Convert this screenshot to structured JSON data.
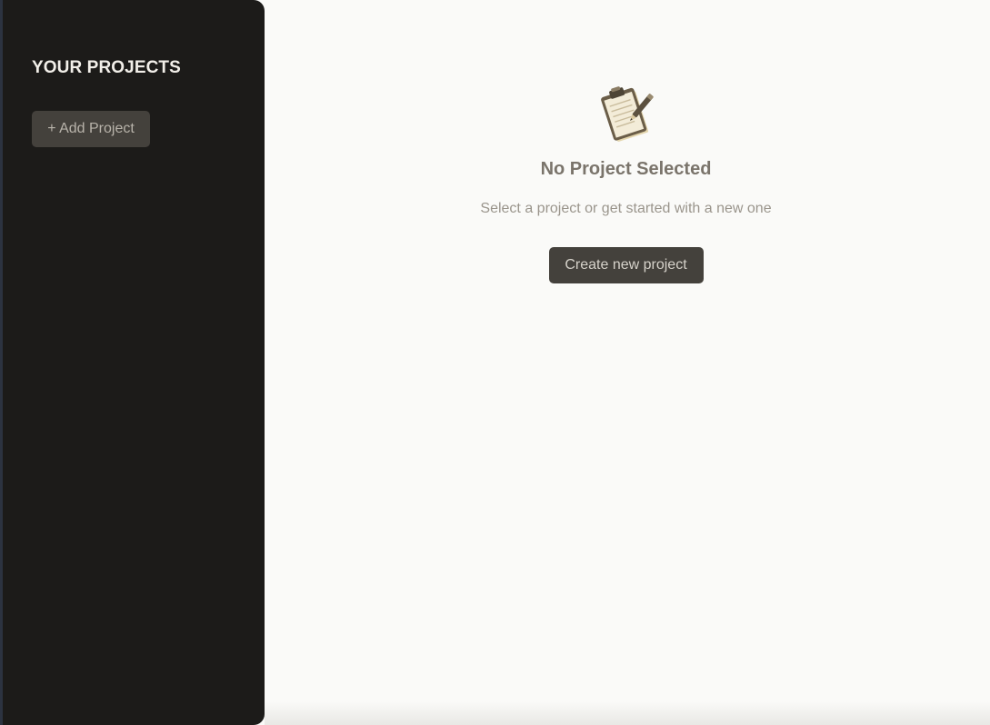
{
  "sidebar": {
    "title": "YOUR PROJECTS",
    "add_button_label": "+ Add Project"
  },
  "main": {
    "empty_state": {
      "icon": "clipboard-icon",
      "title": "No Project Selected",
      "subtitle": "Select a project or get started with a new one",
      "create_button_label": "Create new project"
    }
  },
  "colors": {
    "sidebar_bg": "#1c1b19",
    "main_bg": "#fafaf8",
    "button_bg": "#44413c",
    "title_text": "#7a746b",
    "subtitle_text": "#9a958c"
  }
}
